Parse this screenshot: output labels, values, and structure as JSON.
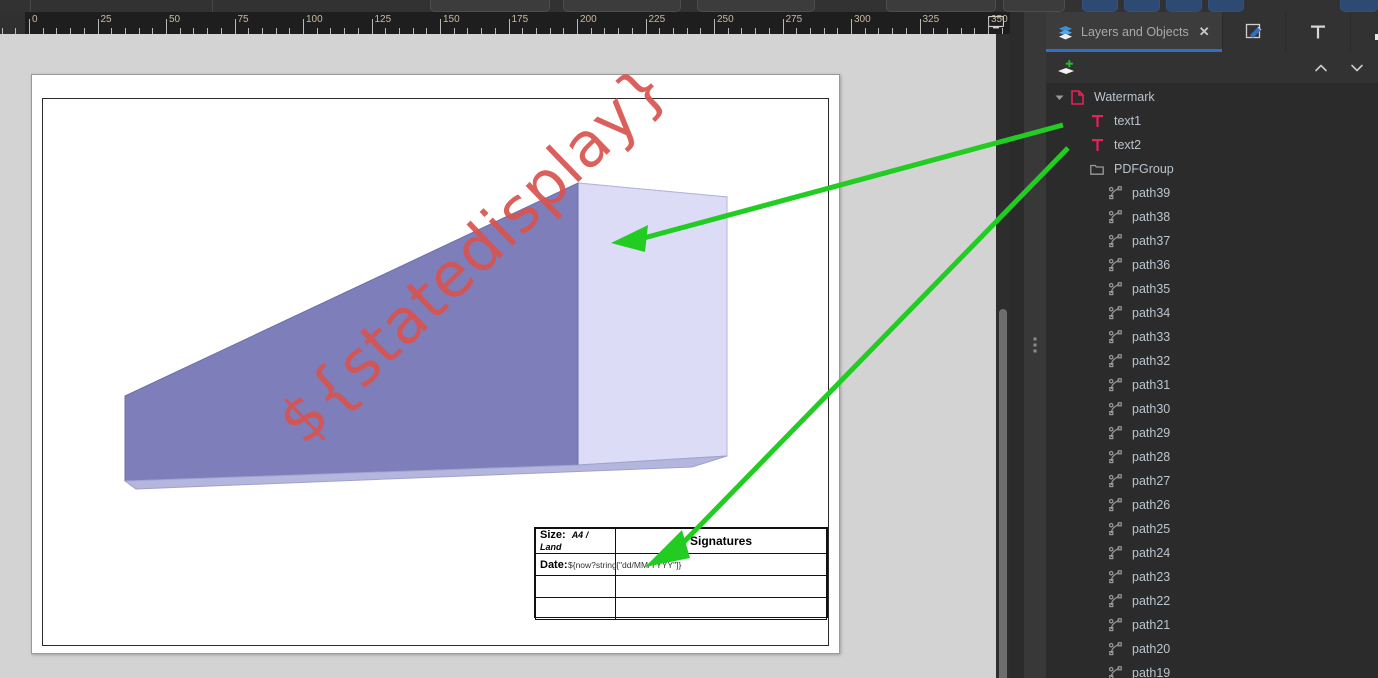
{
  "app": {
    "canvas_bg": "#d3d3d3",
    "panel_bg": "#2b2b2b",
    "accent": "#2f6fc4",
    "annotation_arrow_color": "#22cc22"
  },
  "ruler": {
    "unit_step": 25,
    "labels": [
      "0",
      "25",
      "50",
      "75",
      "100",
      "125",
      "150",
      "175",
      "200",
      "225",
      "250",
      "275",
      "300",
      "325",
      "350"
    ],
    "monitor_icon": "monitor-icon"
  },
  "document": {
    "watermark_text": "${statedisplay}",
    "watermark_color": "#d9534f",
    "model": {
      "name": "extruded-beam",
      "face_front": "#7d7eba",
      "face_right": "#dcdcf7",
      "face_bottom": "#b5b6dd",
      "face_top": "#c9caeb",
      "edge": "#9a9ac8"
    },
    "titleblock": {
      "rows": [
        {
          "key": "Size:",
          "value": "A4 / Land",
          "right": "Signatures"
        },
        {
          "key": "Date:",
          "value": "${now?string[\"dd/MM/YYYY\"]}",
          "right": ""
        },
        {
          "key": "",
          "value": "",
          "right": ""
        },
        {
          "key": "",
          "value": "",
          "right": ""
        }
      ],
      "size_label": "Size:",
      "size_value": "A4 / Land",
      "signatures_label": "Signatures",
      "date_label": "Date:",
      "date_value": "${now?string[\"dd/MM/YYYY\"]}"
    }
  },
  "panel": {
    "tabs": [
      {
        "label": "Layers and Objects",
        "icon": "layers-icon",
        "active": true,
        "closable": true
      },
      {
        "label": "",
        "icon": "pen-edit-icon",
        "active": false,
        "closable": false
      },
      {
        "label": "",
        "icon": "text-tool-icon",
        "active": false,
        "closable": false
      },
      {
        "label": "",
        "icon": "wrench-icon",
        "active": false,
        "closable": false
      }
    ],
    "toolbar": {
      "add_layer": "add-layer-icon",
      "move_up": "chevron-up-icon",
      "move_down": "chevron-down-icon"
    },
    "tree": [
      {
        "label": "Watermark",
        "icon": "page-icon",
        "level": 1,
        "expanded": true
      },
      {
        "label": "text1",
        "icon": "text-icon",
        "level": 2
      },
      {
        "label": "text2",
        "icon": "text-icon",
        "level": 2
      },
      {
        "label": "PDFGroup",
        "icon": "folder-icon",
        "level": 2
      },
      {
        "label": "path39",
        "icon": "path-icon",
        "level": 3
      },
      {
        "label": "path38",
        "icon": "path-icon",
        "level": 3
      },
      {
        "label": "path37",
        "icon": "path-icon",
        "level": 3
      },
      {
        "label": "path36",
        "icon": "path-icon",
        "level": 3
      },
      {
        "label": "path35",
        "icon": "path-icon",
        "level": 3
      },
      {
        "label": "path34",
        "icon": "path-icon",
        "level": 3
      },
      {
        "label": "path33",
        "icon": "path-icon",
        "level": 3
      },
      {
        "label": "path32",
        "icon": "path-icon",
        "level": 3
      },
      {
        "label": "path31",
        "icon": "path-icon",
        "level": 3
      },
      {
        "label": "path30",
        "icon": "path-icon",
        "level": 3
      },
      {
        "label": "path29",
        "icon": "path-icon",
        "level": 3
      },
      {
        "label": "path28",
        "icon": "path-icon",
        "level": 3
      },
      {
        "label": "path27",
        "icon": "path-icon",
        "level": 3
      },
      {
        "label": "path26",
        "icon": "path-icon",
        "level": 3
      },
      {
        "label": "path25",
        "icon": "path-icon",
        "level": 3
      },
      {
        "label": "path24",
        "icon": "path-icon",
        "level": 3
      },
      {
        "label": "path23",
        "icon": "path-icon",
        "level": 3
      },
      {
        "label": "path22",
        "icon": "path-icon",
        "level": 3
      },
      {
        "label": "path21",
        "icon": "path-icon",
        "level": 3
      },
      {
        "label": "path20",
        "icon": "path-icon",
        "level": 3
      },
      {
        "label": "path19",
        "icon": "path-icon",
        "level": 3
      }
    ]
  }
}
